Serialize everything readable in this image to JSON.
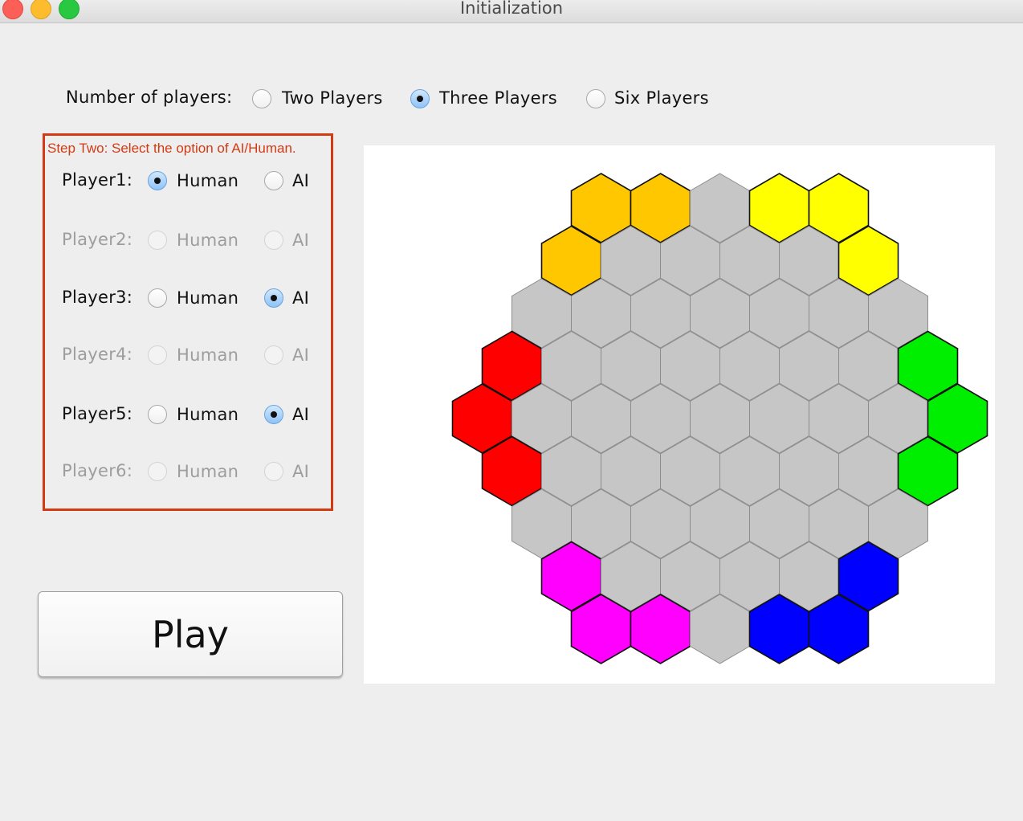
{
  "window": {
    "title": "Initialization"
  },
  "players_count": {
    "label": "Number of players:",
    "options": [
      {
        "label": "Two Players",
        "selected": false
      },
      {
        "label": "Three Players",
        "selected": true
      },
      {
        "label": "Six Players",
        "selected": false
      }
    ]
  },
  "step": {
    "title": "Step Two: Select the option of AI/Human.",
    "border_color": "#d33a14",
    "players": [
      {
        "label": "Player1:",
        "enabled": true,
        "choice": "human",
        "human_label": "Human",
        "ai_label": "AI"
      },
      {
        "label": "Player2:",
        "enabled": false,
        "choice": null,
        "human_label": "Human",
        "ai_label": "AI"
      },
      {
        "label": "Player3:",
        "enabled": true,
        "choice": "ai",
        "human_label": "Human",
        "ai_label": "AI"
      },
      {
        "label": "Player4:",
        "enabled": false,
        "choice": null,
        "human_label": "Human",
        "ai_label": "AI"
      },
      {
        "label": "Player5:",
        "enabled": true,
        "choice": "ai",
        "human_label": "Human",
        "ai_label": "AI"
      },
      {
        "label": "Player6:",
        "enabled": false,
        "choice": null,
        "human_label": "Human",
        "ai_label": "AI"
      }
    ]
  },
  "play_button": {
    "label": "Play"
  },
  "board": {
    "empty_color": "#c6c6c6",
    "rows": [
      {
        "colors": [
          "orange",
          "orange",
          "gray",
          "yellow",
          "yellow"
        ]
      },
      {
        "colors": [
          "orange",
          "gray",
          "gray",
          "gray",
          "gray",
          "yellow"
        ]
      },
      {
        "colors": [
          "gray",
          "gray",
          "gray",
          "gray",
          "gray",
          "gray",
          "gray"
        ]
      },
      {
        "colors": [
          "red",
          "gray",
          "gray",
          "gray",
          "gray",
          "gray",
          "gray",
          "green"
        ]
      },
      {
        "colors": [
          "red",
          "gray",
          "gray",
          "gray",
          "gray",
          "gray",
          "gray",
          "gray",
          "green"
        ]
      },
      {
        "colors": [
          "red",
          "gray",
          "gray",
          "gray",
          "gray",
          "gray",
          "gray",
          "green"
        ]
      },
      {
        "colors": [
          "gray",
          "gray",
          "gray",
          "gray",
          "gray",
          "gray",
          "gray"
        ]
      },
      {
        "colors": [
          "magenta",
          "gray",
          "gray",
          "gray",
          "gray",
          "blue"
        ]
      },
      {
        "colors": [
          "magenta",
          "magenta",
          "gray",
          "blue",
          "blue"
        ]
      }
    ],
    "palette": {
      "gray": "#c6c6c6",
      "orange": "#ffc700",
      "yellow": "#ffff00",
      "red": "#ff0000",
      "green": "#00ee00",
      "magenta": "#ff00ff",
      "blue": "#0000ff"
    }
  }
}
